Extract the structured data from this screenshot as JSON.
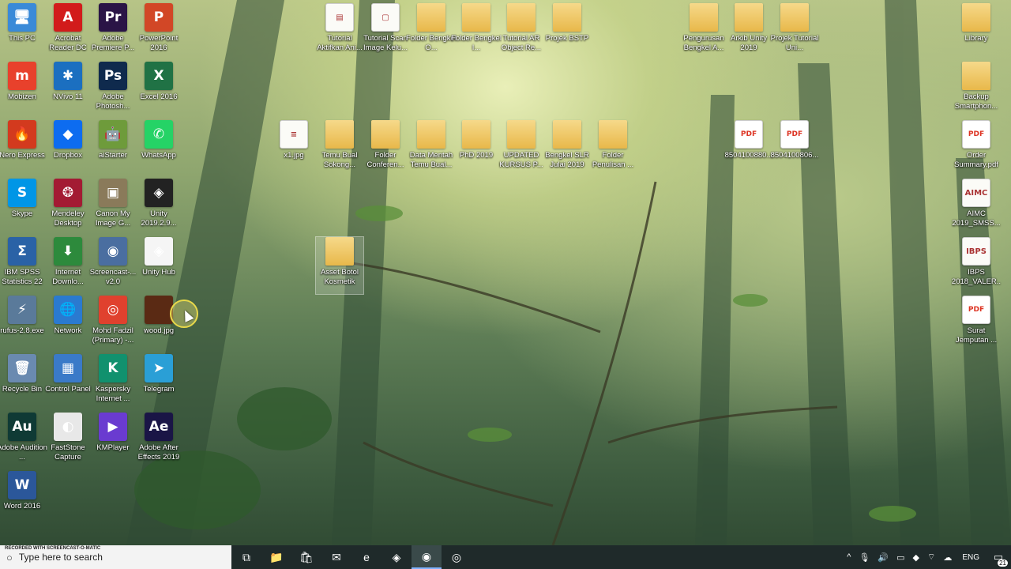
{
  "desktop": {
    "left_icons": [
      {
        "label": "This PC",
        "icon": "this-pc-icon",
        "glyph": "🖥",
        "color": "#3a8ad8"
      },
      {
        "label": "Acrobat Reader DC",
        "icon": "acrobat-icon",
        "glyph": "A",
        "color": "#d21b1b"
      },
      {
        "label": "Adobe Premiere P...",
        "icon": "premiere-icon",
        "glyph": "Pr",
        "color": "#2a1446"
      },
      {
        "label": "PowerPoint 2016",
        "icon": "powerpoint-icon",
        "glyph": "P",
        "color": "#d24726"
      },
      {
        "label": "Mobizen",
        "icon": "mobizen-icon",
        "glyph": "m",
        "color": "#e8412c"
      },
      {
        "label": "NVivo 11",
        "icon": "nvivo-icon",
        "glyph": "✱",
        "color": "#1b6fc0"
      },
      {
        "label": "Adobe Photosh...",
        "icon": "photoshop-icon",
        "glyph": "Ps",
        "color": "#0f2a4d"
      },
      {
        "label": "Excel 2016",
        "icon": "excel-icon",
        "glyph": "X",
        "color": "#207245"
      },
      {
        "label": "Nero Express",
        "icon": "nero-icon",
        "glyph": "🔥",
        "color": "#d33a1e"
      },
      {
        "label": "Dropbox",
        "icon": "dropbox-icon",
        "glyph": "◆",
        "color": "#0d6cf0"
      },
      {
        "label": "aiStarter",
        "icon": "aistarter-icon",
        "glyph": "🤖",
        "color": "#6e9b3b"
      },
      {
        "label": "WhatsApp",
        "icon": "whatsapp-icon",
        "glyph": "✆",
        "color": "#25d366"
      },
      {
        "label": "Skype",
        "icon": "skype-icon",
        "glyph": "S",
        "color": "#0096e6"
      },
      {
        "label": "Mendeley Desktop",
        "icon": "mendeley-icon",
        "glyph": "❂",
        "color": "#a31b33"
      },
      {
        "label": "Canon My Image G...",
        "icon": "canon-icon",
        "glyph": "▣",
        "color": "#8a7a5a"
      },
      {
        "label": "Unity 2019.2.9...",
        "icon": "unity-icon",
        "glyph": "◈",
        "color": "#222222"
      },
      {
        "label": "IBM SPSS Statistics 22",
        "icon": "spss-icon",
        "glyph": "Σ",
        "color": "#2a62a6"
      },
      {
        "label": "Internet Downlo...",
        "icon": "idm-icon",
        "glyph": "⬇",
        "color": "#2d8a3c"
      },
      {
        "label": "Screencast-... v2.0",
        "icon": "screencast-icon",
        "glyph": "◉",
        "color": "#4a6ea0"
      },
      {
        "label": "Unity Hub",
        "icon": "unity-hub-icon",
        "glyph": "◈",
        "color": "#f5f5f5"
      },
      {
        "label": "rufus-2.8.exe",
        "icon": "rufus-icon",
        "glyph": "⚡",
        "color": "#5a7a9a"
      },
      {
        "label": "Network",
        "icon": "network-icon",
        "glyph": "🌐",
        "color": "#2a7ad0"
      },
      {
        "label": "Mohd Fadzil (Primary) -...",
        "icon": "chrome-icon",
        "glyph": "◎",
        "color": "#e0412e"
      },
      {
        "label": "wood.jpg",
        "icon": "wood-image-icon",
        "glyph": "",
        "color": "#5a2a14"
      },
      {
        "label": "Recycle Bin",
        "icon": "recycle-bin-icon",
        "glyph": "🗑",
        "color": "#6a8ab0"
      },
      {
        "label": "Control Panel",
        "icon": "control-panel-icon",
        "glyph": "▦",
        "color": "#3a7ac8"
      },
      {
        "label": "Kaspersky Internet ...",
        "icon": "kaspersky-icon",
        "glyph": "K",
        "color": "#11916e"
      },
      {
        "label": "Telegram",
        "icon": "telegram-icon",
        "glyph": "➤",
        "color": "#2a9fd6"
      },
      {
        "label": "Adobe Audition ...",
        "icon": "audition-icon",
        "glyph": "Au",
        "color": "#0f3a35"
      },
      {
        "label": "FastStone Capture",
        "icon": "faststone-icon",
        "glyph": "◐",
        "color": "#e8e8e8"
      },
      {
        "label": "KMPlayer",
        "icon": "kmplayer-icon",
        "glyph": "▶",
        "color": "#6a3bd0"
      },
      {
        "label": "Adobe After Effects 2019",
        "icon": "after-effects-icon",
        "glyph": "Ae",
        "color": "#1a1546"
      },
      {
        "label": "Word 2016",
        "icon": "word-icon",
        "glyph": "W",
        "color": "#2b579a"
      }
    ],
    "top_icons": [
      {
        "label": "Tutorial Aktifkan Ani...",
        "kind": "doc",
        "glyph": "▤"
      },
      {
        "label": "Tutorial Scan Image Kelu...",
        "kind": "doc",
        "glyph": "▢"
      },
      {
        "label": "Folder Bengkel O...",
        "kind": "folder",
        "glyph": ""
      },
      {
        "label": "Folder Bengkel I...",
        "kind": "folder",
        "glyph": ""
      },
      {
        "label": "Tutorial AR Object Re...",
        "kind": "folder",
        "glyph": ""
      },
      {
        "label": "Projek BSTP",
        "kind": "folder",
        "glyph": ""
      },
      {
        "label": "Pengurusan Bengkel A...",
        "kind": "folder",
        "glyph": ""
      },
      {
        "label": "Arkib Unity 2019",
        "kind": "folder",
        "glyph": ""
      },
      {
        "label": "Projek Tutorial Uni...",
        "kind": "folder",
        "glyph": ""
      },
      {
        "label": "Library",
        "kind": "folder",
        "glyph": ""
      }
    ],
    "mid_icons": [
      {
        "label": "x1.jpg",
        "kind": "doc",
        "glyph": "≡"
      },
      {
        "label": "Temu Bual Sokong...",
        "kind": "folder",
        "glyph": ""
      },
      {
        "label": "Folder Conferen...",
        "kind": "folder",
        "glyph": ""
      },
      {
        "label": "Data Mentah Temu Bual...",
        "kind": "folder",
        "glyph": ""
      },
      {
        "label": "PhD 2019",
        "kind": "folder",
        "glyph": ""
      },
      {
        "label": "UPDATED KURSUS P...",
        "kind": "folder",
        "glyph": ""
      },
      {
        "label": "Bengkel SLR Julai 2019",
        "kind": "folder",
        "glyph": ""
      },
      {
        "label": "Folder Penulisan ...",
        "kind": "folder",
        "glyph": ""
      },
      {
        "label": "8504100880...",
        "kind": "pdf",
        "glyph": "PDF"
      },
      {
        "label": "8504100806...",
        "kind": "pdf",
        "glyph": "PDF"
      }
    ],
    "selected_icon": {
      "label": "Asset Botol Kosmetik",
      "kind": "folder"
    },
    "right_icons": [
      {
        "label": "Backup Smartphon...",
        "kind": "folder",
        "glyph": ""
      },
      {
        "label": "Order Summary.pdf",
        "kind": "pdf",
        "glyph": "PDF"
      },
      {
        "label": "AIMC 2019_SMSS...",
        "kind": "doc",
        "glyph": "AIMC"
      },
      {
        "label": "IBPS 2018_VALER...",
        "kind": "doc",
        "glyph": "IBPS"
      },
      {
        "label": "Surat Jemputan ...",
        "kind": "pdf",
        "glyph": "PDF"
      }
    ]
  },
  "taskbar": {
    "search_placeholder": "Type here to search",
    "recorder_text": "RECORDED WITH SCREENCAST-O-MATIC",
    "buttons": [
      {
        "icon": "task-view-icon",
        "glyph": "⧉"
      },
      {
        "icon": "file-explorer-icon",
        "glyph": "📁"
      },
      {
        "icon": "store-icon",
        "glyph": "🛍"
      },
      {
        "icon": "mail-icon",
        "glyph": "✉"
      },
      {
        "icon": "edge-icon",
        "glyph": "e"
      },
      {
        "icon": "unity-taskbar-icon",
        "glyph": "◈"
      },
      {
        "icon": "screencast-taskbar-icon",
        "glyph": "◉"
      },
      {
        "icon": "chrome-taskbar-icon",
        "glyph": "◎"
      }
    ],
    "tray": {
      "icons": [
        {
          "icon": "chevron-up-icon",
          "glyph": "^"
        },
        {
          "icon": "microphone-icon",
          "glyph": "🎙"
        },
        {
          "icon": "volume-icon",
          "glyph": "🔊"
        },
        {
          "icon": "display-icon",
          "glyph": "▭"
        },
        {
          "icon": "dropbox-tray-icon",
          "glyph": "◆"
        },
        {
          "icon": "wifi-icon",
          "glyph": "⌔"
        },
        {
          "icon": "onedrive-icon",
          "glyph": "☁"
        }
      ],
      "language": "ENG",
      "notification_count": "21"
    }
  }
}
